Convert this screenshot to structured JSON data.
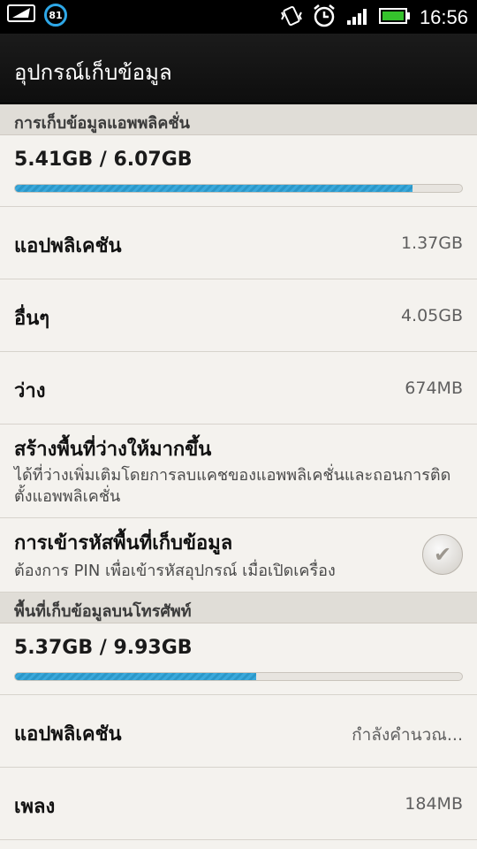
{
  "status": {
    "battery_badge": "81",
    "time": "16:56"
  },
  "header": {
    "title": "อุปกรณ์เก็บข้อมูล"
  },
  "app_storage": {
    "section_title": "การเก็บข้อมูลแอพพลิคชั่น",
    "summary": "5.41GB / 6.07GB",
    "used_fraction": 0.89,
    "items": [
      {
        "label": "แอปพลิเคชัน",
        "value": "1.37GB"
      },
      {
        "label": "อื่นๆ",
        "value": "4.05GB"
      },
      {
        "label": "ว่าง",
        "value": "674MB"
      }
    ],
    "free_space": {
      "title": "สร้างพื้นที่ว่างให้มากขึ้น",
      "desc": "ได้ที่ว่างเพิ่มเติมโดยการลบแคชของแอพพลิเคชั่นและถอนการติดตั้งแอพพลิเคชั่น"
    },
    "encrypt": {
      "title": "การเข้ารหัสพื้นที่เก็บข้อมูล",
      "desc": "ต้องการ PIN เพื่อเข้ารหัสอุปกรณ์ เมื่อเปิดเครื่อง"
    }
  },
  "phone_storage": {
    "section_title": "พื้นที่เก็บข้อมูลบนโทรศัพท์",
    "summary": "5.37GB / 9.93GB",
    "used_fraction": 0.54,
    "items": [
      {
        "label": "แอปพลิเคชัน",
        "value": "กำลังคำนวณ..."
      },
      {
        "label": "เพลง",
        "value": "184MB"
      }
    ]
  }
}
